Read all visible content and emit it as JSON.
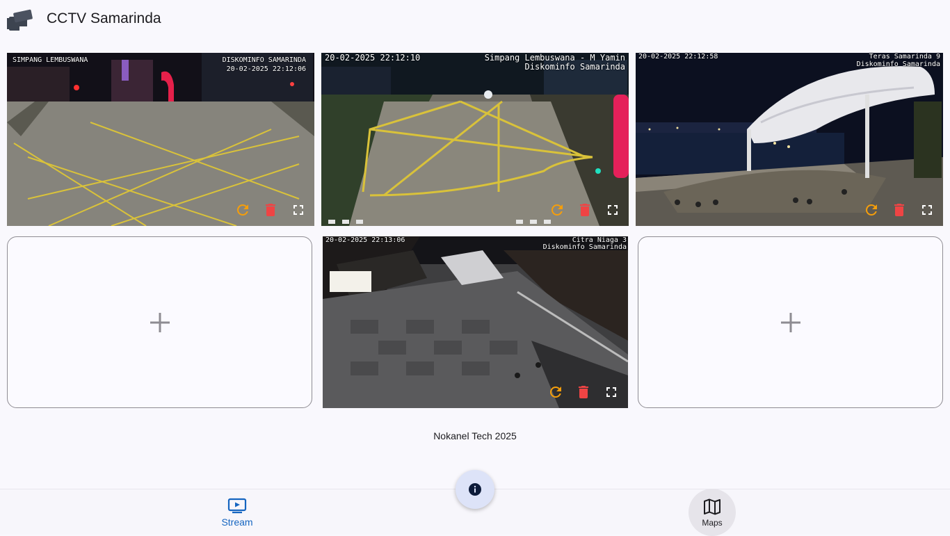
{
  "app": {
    "title": "CCTV Samarinda",
    "logo_icon": "cctv-camera-icon"
  },
  "cameras": [
    {
      "osd_top_left": "SIMPANG LEMBUSWANA",
      "osd_top_right_1": "DISKOMINFO SAMARINDA",
      "osd_top_right_2": "20-02-2025 22:12:06",
      "scene": "night road intersection with yellow box junction"
    },
    {
      "osd_top_left": "20-02-2025 22:12:10",
      "osd_top_right_1": "Simpang Lembuswana - M Yamin",
      "osd_top_right_2": "Diskominfo Samarinda",
      "scene": "night road intersection viewed from above"
    },
    {
      "osd_top_left": "20-02-2025 22:12:58",
      "osd_top_right_1": "Teras Samarinda 9",
      "osd_top_right_2": "Diskominfo Samarinda",
      "scene": "riverside plaza with white tensile canopy"
    },
    {
      "osd_top_left": "20-02-2025 22:13:06",
      "osd_top_right_1": "Citra Niaga 3",
      "osd_top_right_2": "Diskominfo Samarinda",
      "scene": "pedestrian plaza with tiled floor and stairs"
    }
  ],
  "camera_controls": {
    "refresh_icon": "refresh-icon",
    "delete_icon": "delete-icon",
    "fullscreen_icon": "fullscreen-icon",
    "refresh_color": "#f59e0b",
    "delete_color": "#ef4444",
    "fullscreen_color": "#ffffff"
  },
  "empty_slots": [
    {
      "icon": "add-icon"
    },
    {
      "icon": "add-icon"
    }
  ],
  "footer": {
    "text": "Nokanel Tech 2025"
  },
  "bottom_nav": {
    "items": [
      {
        "label": "Stream",
        "icon": "stream-tv-icon",
        "active": true
      },
      {
        "label": "Maps",
        "icon": "map-icon",
        "active": false
      }
    ]
  },
  "fab": {
    "icon": "info-icon"
  },
  "colors": {
    "accent": "#1565c0",
    "background": "#f9f8fd",
    "fab_background": "#dde3f8"
  }
}
